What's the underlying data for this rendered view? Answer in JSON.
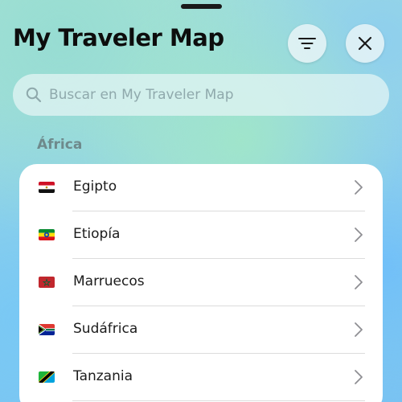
{
  "header": {
    "title": "My Traveler Map",
    "filter_icon": "filter-lines-icon",
    "close_icon": "close-icon"
  },
  "search": {
    "placeholder": "Buscar en My Traveler Map",
    "value": ""
  },
  "section": {
    "title": "África"
  },
  "countries": [
    {
      "name": "Egipto",
      "flag": "egypt-flag-icon"
    },
    {
      "name": "Etiopía",
      "flag": "ethiopia-flag-icon"
    },
    {
      "name": "Marruecos",
      "flag": "morocco-flag-icon"
    },
    {
      "name": "Sudáfrica",
      "flag": "south-africa-flag-icon"
    },
    {
      "name": "Tanzania",
      "flag": "tanzania-flag-icon"
    }
  ]
}
